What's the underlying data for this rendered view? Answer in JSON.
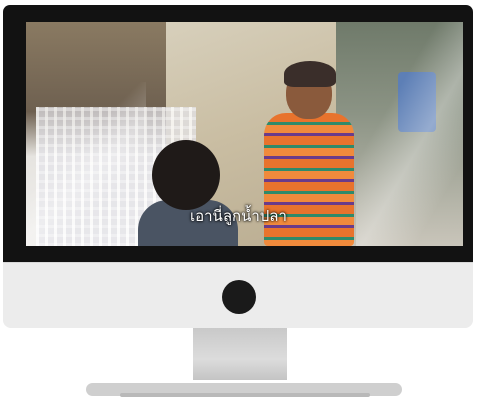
{
  "monitor": {
    "screen": {
      "subtitle": "เอานี่ลูกน้ำปลา"
    }
  },
  "icons": {
    "camera": "camera-dot-icon"
  },
  "colors": {
    "bezel": "#121212",
    "chin": "#ececec",
    "stand": "#cfcfcf",
    "subtitle": "#ffffff"
  }
}
